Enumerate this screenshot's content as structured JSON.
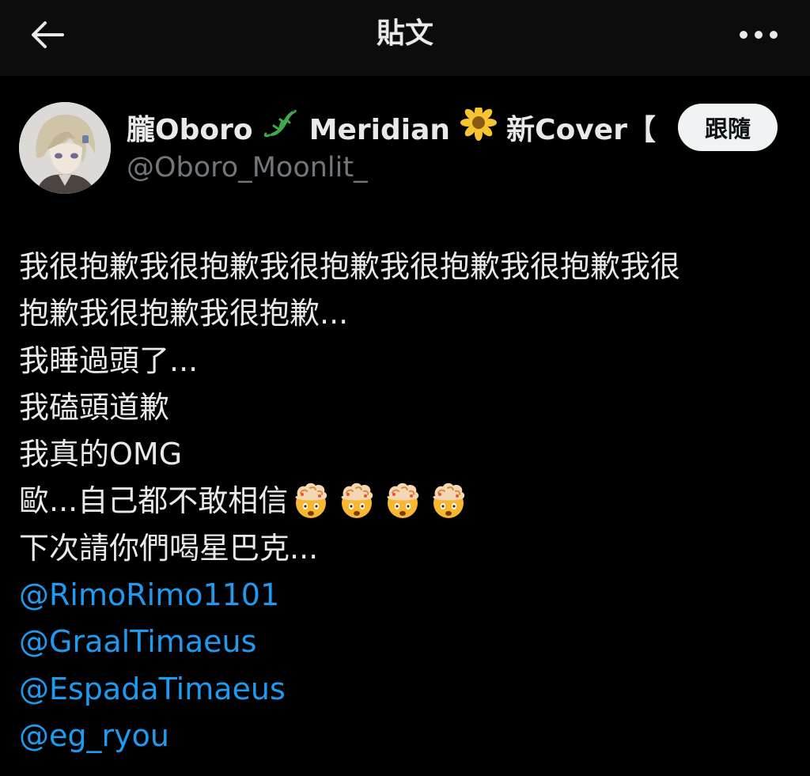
{
  "header": {
    "title": "貼文",
    "back_icon": "back-arrow-icon",
    "more_icon": "more-horizontal-icon"
  },
  "author": {
    "name_part1": "朧Oboro",
    "name_part2": "Meridian",
    "name_part3": "新Cover【...",
    "handle": "@Oboro_Moonlit_",
    "follow_label": "跟隨",
    "emoji_1": "lizard-icon",
    "emoji_2": "blossom-icon"
  },
  "tweet": {
    "line1": "我很抱歉我很抱歉我很抱歉我很抱歉我很抱歉我很",
    "line2": "抱歉我很抱歉我很抱歉...",
    "line3": "我睡過頭了...",
    "line4": "我磕頭道歉",
    "line5": "我真的OMG",
    "line6": "歐...自己都不敢相信",
    "line6_emoji": "exploding-head-icon",
    "line6_emoji_count": 4,
    "line7": "下次請你們喝星巴克...",
    "mentions": [
      "@RimoRimo1101",
      "@GraalTimaeus",
      "@EspadaTimaeus",
      "@eg_ryou"
    ]
  },
  "colors": {
    "background": "#000000",
    "header_background": "#0c0c0d",
    "text": "#e7e9ea",
    "secondary_text": "#71767b",
    "link": "#1d9bf0",
    "follow_button_bg": "#eff3f4"
  }
}
